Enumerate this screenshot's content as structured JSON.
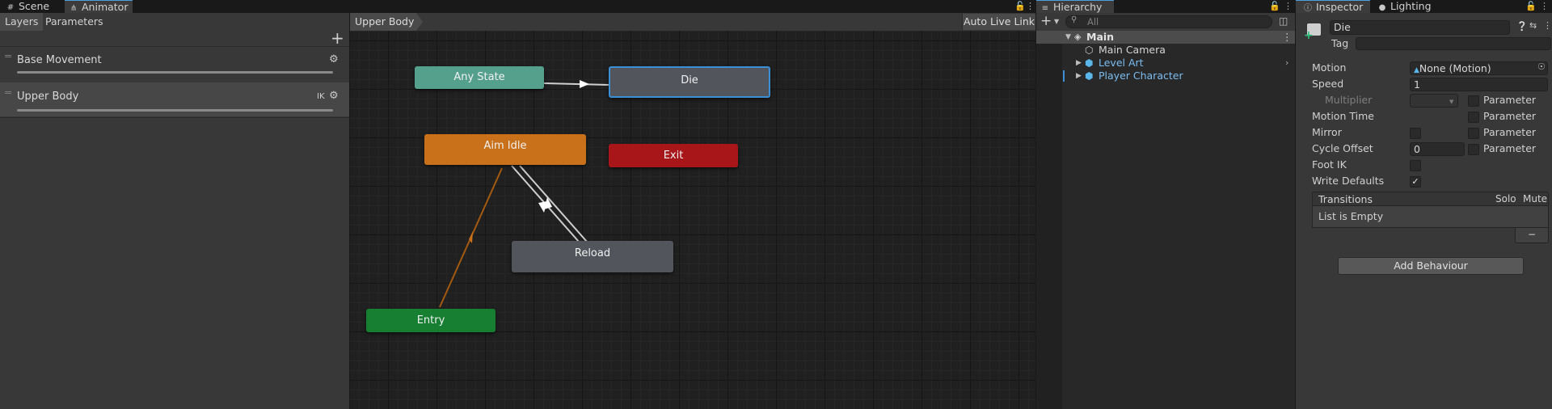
{
  "animator_window": {
    "tabs": [
      {
        "label": "Scene",
        "icon": "scene-icon"
      },
      {
        "label": "Animator",
        "icon": "animator-icon"
      }
    ],
    "left_tabs": [
      "Layers",
      "Parameters"
    ],
    "layers": [
      {
        "name": "Base Movement",
        "ik": ""
      },
      {
        "name": "Upper Body",
        "ik": "IK"
      }
    ],
    "breadcrumb": "Upper Body",
    "auto_live_link": "Auto Live Link",
    "states": {
      "any_state": "Any State",
      "die": "Die",
      "aim_idle": "Aim Idle",
      "exit": "Exit",
      "reload": "Reload",
      "entry": "Entry"
    },
    "colors": {
      "any_state": "#55a08d",
      "die": "#52555c",
      "aim_idle": "#c8701a",
      "exit": "#a8161a",
      "reload": "#52555c",
      "entry": "#167f32",
      "selected_outline": "#3b8fd6"
    }
  },
  "hierarchy": {
    "tab_label": "Hierarchy",
    "search_placeholder": "All",
    "items": [
      {
        "label": "Main",
        "depth": 0
      },
      {
        "label": "Main Camera",
        "depth": 1
      },
      {
        "label": "Level Art",
        "depth": 1
      },
      {
        "label": "Player Character",
        "depth": 1
      }
    ]
  },
  "inspector": {
    "tabs": [
      {
        "label": "Inspector",
        "icon": "info-icon"
      },
      {
        "label": "Lighting",
        "icon": "bulb-icon"
      }
    ],
    "name": "Die",
    "tag_label": "Tag",
    "motion": {
      "label": "Motion",
      "value": "None (Motion)"
    },
    "speed": {
      "label": "Speed",
      "value": "1"
    },
    "multiplier": {
      "label": "Multiplier",
      "param": "Parameter"
    },
    "motion_time": {
      "label": "Motion Time",
      "param": "Parameter"
    },
    "mirror": {
      "label": "Mirror",
      "param": "Parameter"
    },
    "cycle_offset": {
      "label": "Cycle Offset",
      "value": "0",
      "param": "Parameter"
    },
    "foot_ik": {
      "label": "Foot IK"
    },
    "write_defaults": {
      "label": "Write Defaults",
      "checked": true
    },
    "transitions": {
      "header": "Transitions",
      "solo": "Solo",
      "mute": "Mute",
      "empty": "List is Empty",
      "remove": "−"
    },
    "add_behaviour": "Add Behaviour"
  }
}
